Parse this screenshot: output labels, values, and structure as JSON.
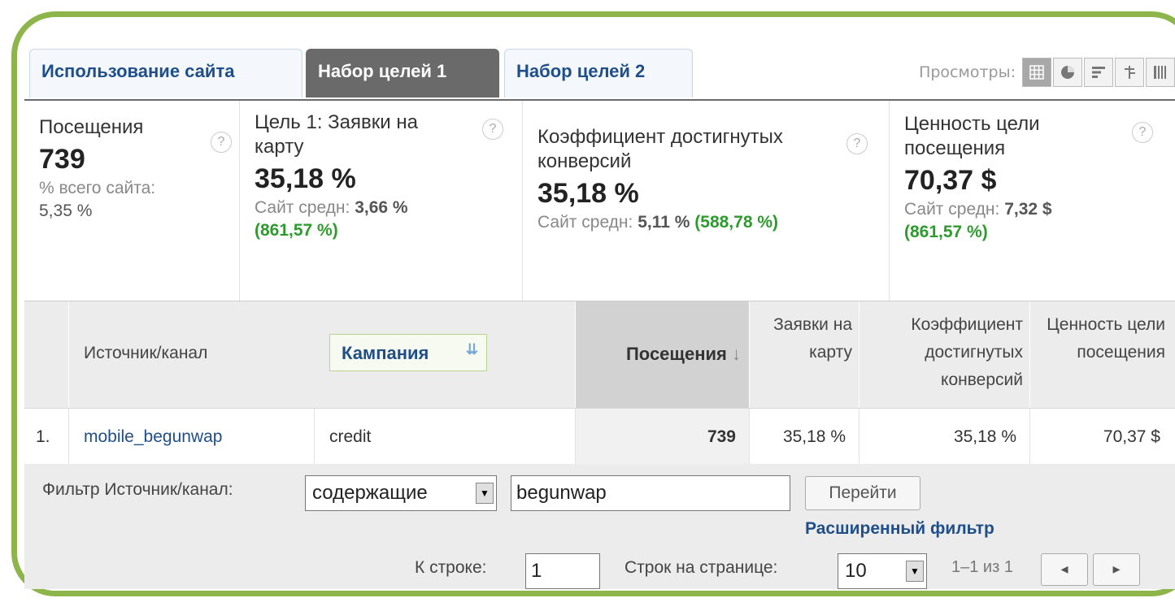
{
  "tabs": [
    "Использование сайта",
    "Набор целей 1",
    "Набор целей 2"
  ],
  "views": {
    "label": "Просмотры:",
    "icons": [
      "grid-icon",
      "pie-icon",
      "bar-icon",
      "compare-icon",
      "pivot-icon"
    ]
  },
  "summary": [
    {
      "label": "Посещения",
      "value": "739",
      "sub1": "% всего сайта:",
      "sub2": "5,35 %"
    },
    {
      "label": "Цель 1: Заявки на карту",
      "value": "35,18 %",
      "sub1": "Сайт средн:",
      "sub1b": "3,66 %",
      "sub2": "(861,57 %)"
    },
    {
      "label": "Коэффициент достигнутых конверсий",
      "value": "35,18 %",
      "sub1": "Сайт средн:",
      "sub1b": "5,11 %",
      "sub2": "(588,78 %)"
    },
    {
      "label": "Ценность цели посещения",
      "value": "70,37 $",
      "sub1": "Сайт средн:",
      "sub1b": "7,32 $",
      "sub2": "(861,57 %)"
    }
  ],
  "help": "?",
  "table": {
    "headers": {
      "source": "Источник/канал",
      "campaign": "Кампания",
      "visits": "Посещения",
      "visits_sort": "↓",
      "goal": "Заявки на карту",
      "conv": "Коэффициент достигнутых конверсий",
      "value": "Ценность цели посещения"
    },
    "rows": [
      {
        "num": "1.",
        "source": "mobile_begunwap",
        "campaign": "credit",
        "visits": "739",
        "goal": "35,18 %",
        "conv": "35,18 %",
        "value": "70,37 $"
      }
    ]
  },
  "filter": {
    "label": "Фильтр Источник/канал:",
    "mode": "содержащие",
    "value": "begunwap",
    "go": "Перейти",
    "advanced": "Расширенный фильтр"
  },
  "pager": {
    "row_label": "К строке:",
    "row_value": "1",
    "per_page_label": "Строк на странице:",
    "per_page": "10",
    "range": "1–1 из 1",
    "prev": "◂",
    "next": "▸"
  }
}
